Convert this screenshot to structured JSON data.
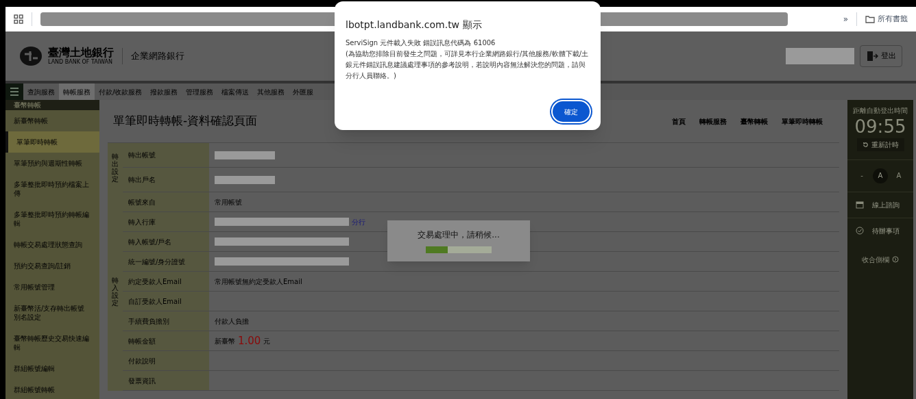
{
  "browser": {
    "bookmarks_overflow": "»",
    "bookmarks_folder": "所有書籤"
  },
  "header": {
    "bank_name": "臺灣土地銀行",
    "bank_name_en": "LAND BANK OF TAIWAN",
    "product": "企業網路銀行",
    "logout": "登出"
  },
  "nav": [
    {
      "label": "查詢服務",
      "selected": false
    },
    {
      "label": "轉帳服務",
      "selected": true
    },
    {
      "label": "付款/收款服務",
      "selected": false
    },
    {
      "label": "撥款服務",
      "selected": false
    },
    {
      "label": "管理服務",
      "selected": false
    },
    {
      "label": "檔案傳送",
      "selected": false
    },
    {
      "label": "其他服務",
      "selected": false
    },
    {
      "label": "外匯服",
      "selected": false
    }
  ],
  "sidebar": {
    "heading": "臺幣轉帳",
    "items": [
      {
        "label": "新臺幣轉帳",
        "selected": false
      },
      {
        "label": "單筆即時轉帳",
        "selected": true
      },
      {
        "label": "單筆預約與週期性轉帳",
        "selected": false
      },
      {
        "label": "多筆整批即時預約檔案上傳",
        "selected": false
      },
      {
        "label": "多筆整批即時預約轉帳編輯",
        "selected": false
      },
      {
        "label": "轉帳交易處理狀態查詢",
        "selected": false
      },
      {
        "label": "預約交易查詢/註銷",
        "selected": false
      },
      {
        "label": "常用帳號管理",
        "selected": false
      },
      {
        "label": "新臺幣活/支存轉出帳號別名設定",
        "selected": false
      },
      {
        "label": "臺幣轉帳歷史交易快速編輯",
        "selected": false
      },
      {
        "label": "群組帳號編輯",
        "selected": false
      },
      {
        "label": "群組帳號轉帳",
        "selected": false
      }
    ]
  },
  "page": {
    "title": "單筆即時轉帳-資料確認頁面",
    "breadcrumb": [
      "首頁",
      "轉帳服務",
      "臺幣轉帳",
      "單筆即時轉帳"
    ]
  },
  "form": {
    "groups": [
      {
        "label": "轉出設定",
        "rows": [
          {
            "label": "轉出帳號",
            "kind": "redacted"
          },
          {
            "label": "轉出戶名",
            "kind": "redacted"
          }
        ]
      },
      {
        "label": "轉入設定",
        "rows": [
          {
            "label": "帳號來自",
            "kind": "text",
            "value": "常用帳號"
          },
          {
            "label": "轉入行庫",
            "kind": "redacted_suffix",
            "suffix": "分行"
          },
          {
            "label": "轉入帳號/戶名",
            "kind": "redacted"
          },
          {
            "label": "統一編號/身分證號",
            "kind": "redacted"
          },
          {
            "label": "約定受款人Email",
            "kind": "text",
            "value": "常用帳號無約定受款人Email"
          },
          {
            "label": "自訂受款人Email",
            "kind": "empty"
          },
          {
            "label": "手續費負擔別",
            "kind": "text",
            "value": "付款人負擔"
          },
          {
            "label": "轉帳金額",
            "kind": "amount",
            "currency": "新臺幣",
            "amount": "1.00",
            "unit": "元"
          },
          {
            "label": "付款說明",
            "kind": "empty"
          },
          {
            "label": "發票資訊",
            "kind": "empty"
          }
        ]
      }
    ]
  },
  "right_panel": {
    "timer_label": "距離自動登出時間",
    "timer": "09:55",
    "reset": "重新計時",
    "font_sizes": [
      {
        "label": "-",
        "selected": false
      },
      {
        "label": "A",
        "selected": true
      },
      {
        "label": "A",
        "selected": false
      }
    ],
    "links": [
      {
        "label": "線上諮詢",
        "kind": "calendar"
      },
      {
        "label": "待辦事項",
        "kind": "check"
      }
    ],
    "collapse": "收合側欄"
  },
  "loading": {
    "message": "交易處理中，請稍候...",
    "level": 0.33
  },
  "dialog": {
    "title": "lbotpt.landbank.com.tw 顯示",
    "message_lines": [
      "ServiSign 元件載入失敗 錯誤訊息代碼為 61006",
      "(為協助您排除目前發生之問題，可詳見本行企業網路銀行/其他服務/軟體下載/土銀元件錯誤訊息建議處理事項的參考說明，若說明內容無法解決您的問題，請與分行人員聯絡。)"
    ],
    "ok": "確定"
  }
}
